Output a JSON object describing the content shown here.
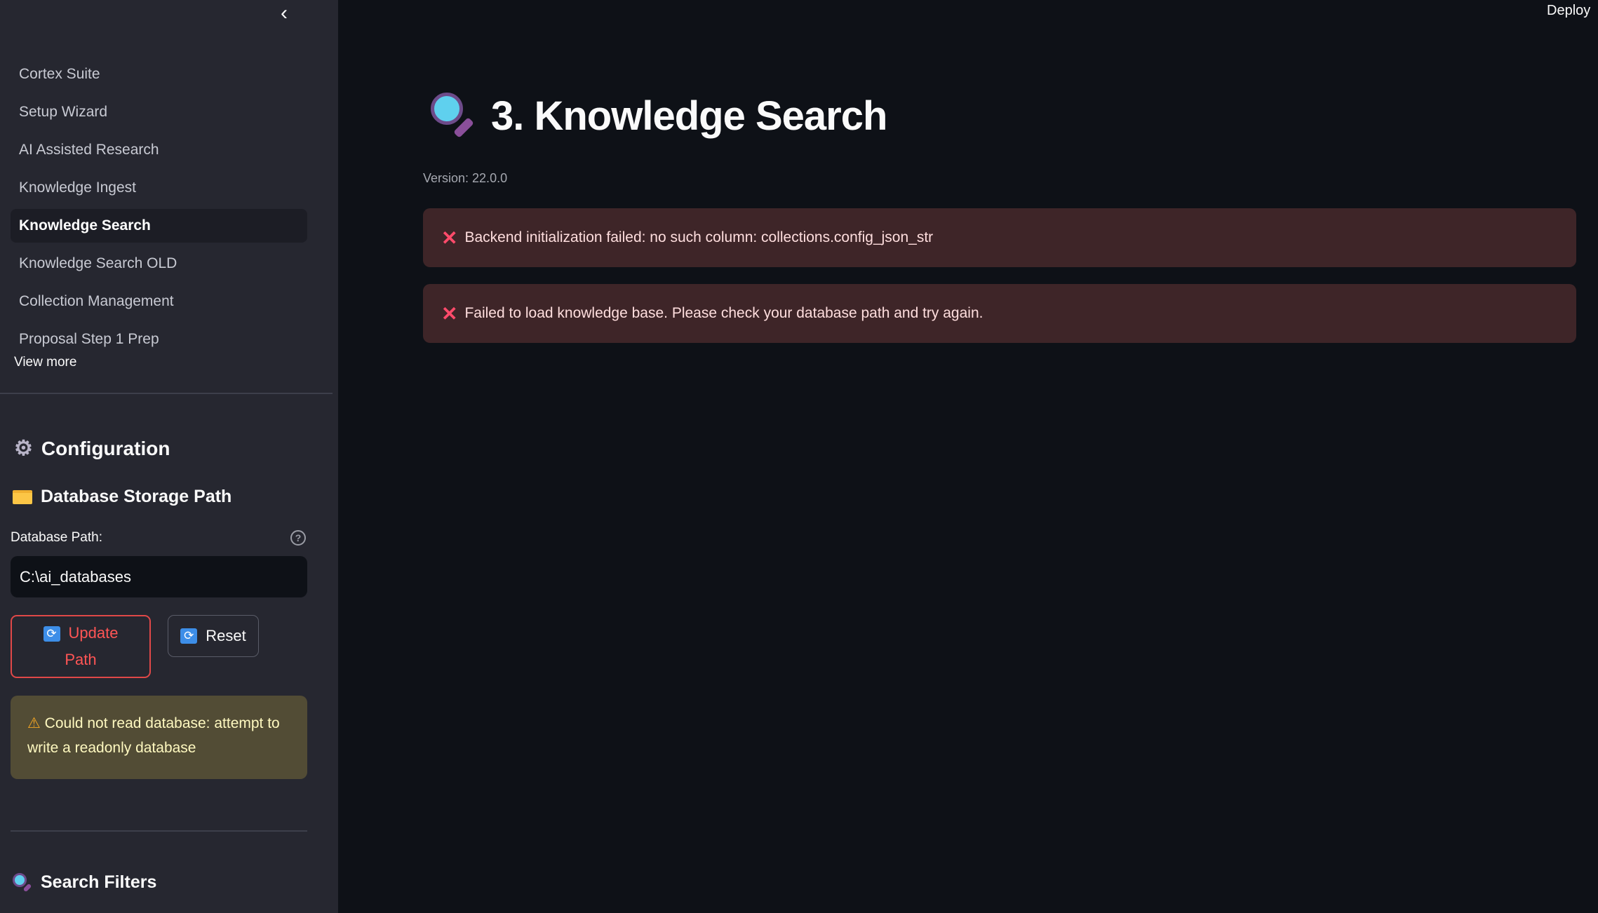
{
  "header": {
    "deploy_label": "Deploy"
  },
  "sidebar": {
    "nav_items": [
      {
        "label": "Cortex Suite"
      },
      {
        "label": "Setup Wizard"
      },
      {
        "label": "AI Assisted Research"
      },
      {
        "label": "Knowledge Ingest"
      },
      {
        "label": "Knowledge Search",
        "active": true
      },
      {
        "label": "Knowledge Search OLD"
      },
      {
        "label": "Collection Management"
      },
      {
        "label": "Proposal Step 1 Prep"
      }
    ],
    "view_more": "View more",
    "configuration_title": "Configuration",
    "db_section_title": "Database Storage Path",
    "db_path_label": "Database Path:",
    "db_path_value": "C:\\ai_databases",
    "update_button": "Update Path",
    "reset_button": "Reset",
    "warning": "Could not read database: attempt to write a readonly database",
    "search_filters_title": "Search Filters"
  },
  "main": {
    "title": "3. Knowledge Search",
    "version": "Version: 22.0.0",
    "errors": [
      "Backend initialization failed: no such column: collections.config_json_str",
      "Failed to load knowledge base. Please check your database path and try again."
    ]
  },
  "colors": {
    "sidebar_bg": "#262730",
    "main_bg": "#0e1117",
    "error_bg": "#3e2528",
    "warning_bg": "#524c35",
    "accent_red": "#ff4b4b"
  }
}
